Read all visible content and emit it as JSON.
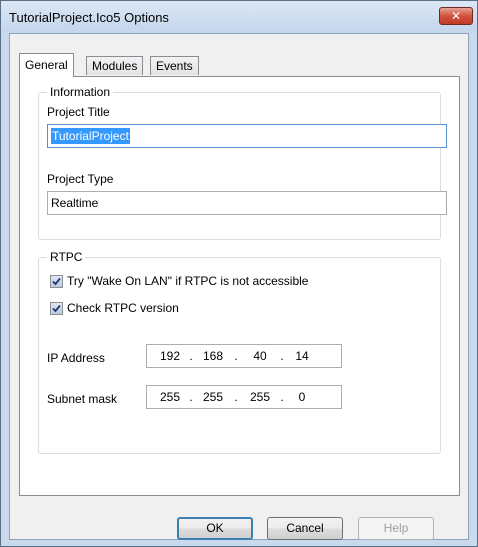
{
  "window": {
    "title": "TutorialProject.Ico5 Options",
    "close_glyph": "✕"
  },
  "tabs": [
    {
      "label": "General",
      "active": true
    },
    {
      "label": "Modules",
      "active": false
    },
    {
      "label": "Events",
      "active": false
    }
  ],
  "information": {
    "legend": "Information",
    "project_title_label": "Project Title",
    "project_title_value": "TutorialProject",
    "project_type_label": "Project Type",
    "project_type_value": "Realtime"
  },
  "rtpc": {
    "legend": "RTPC",
    "wake_on_lan": {
      "label": "Try \"Wake On LAN\" if RTPC is not accessible",
      "checked": true
    },
    "check_version": {
      "label": "Check RTPC version",
      "checked": true
    },
    "ip_label": "IP Address",
    "ip": [
      "192",
      "168",
      "40",
      "14"
    ],
    "subnet_label": "Subnet mask",
    "subnet": [
      "255",
      "255",
      "255",
      "0"
    ],
    "separator": "."
  },
  "buttons": {
    "ok": "OK",
    "cancel": "Cancel",
    "help": "Help"
  },
  "colors": {
    "selection": "#3399ff",
    "close_button": "#c23a26",
    "frame": "#c9daed"
  }
}
